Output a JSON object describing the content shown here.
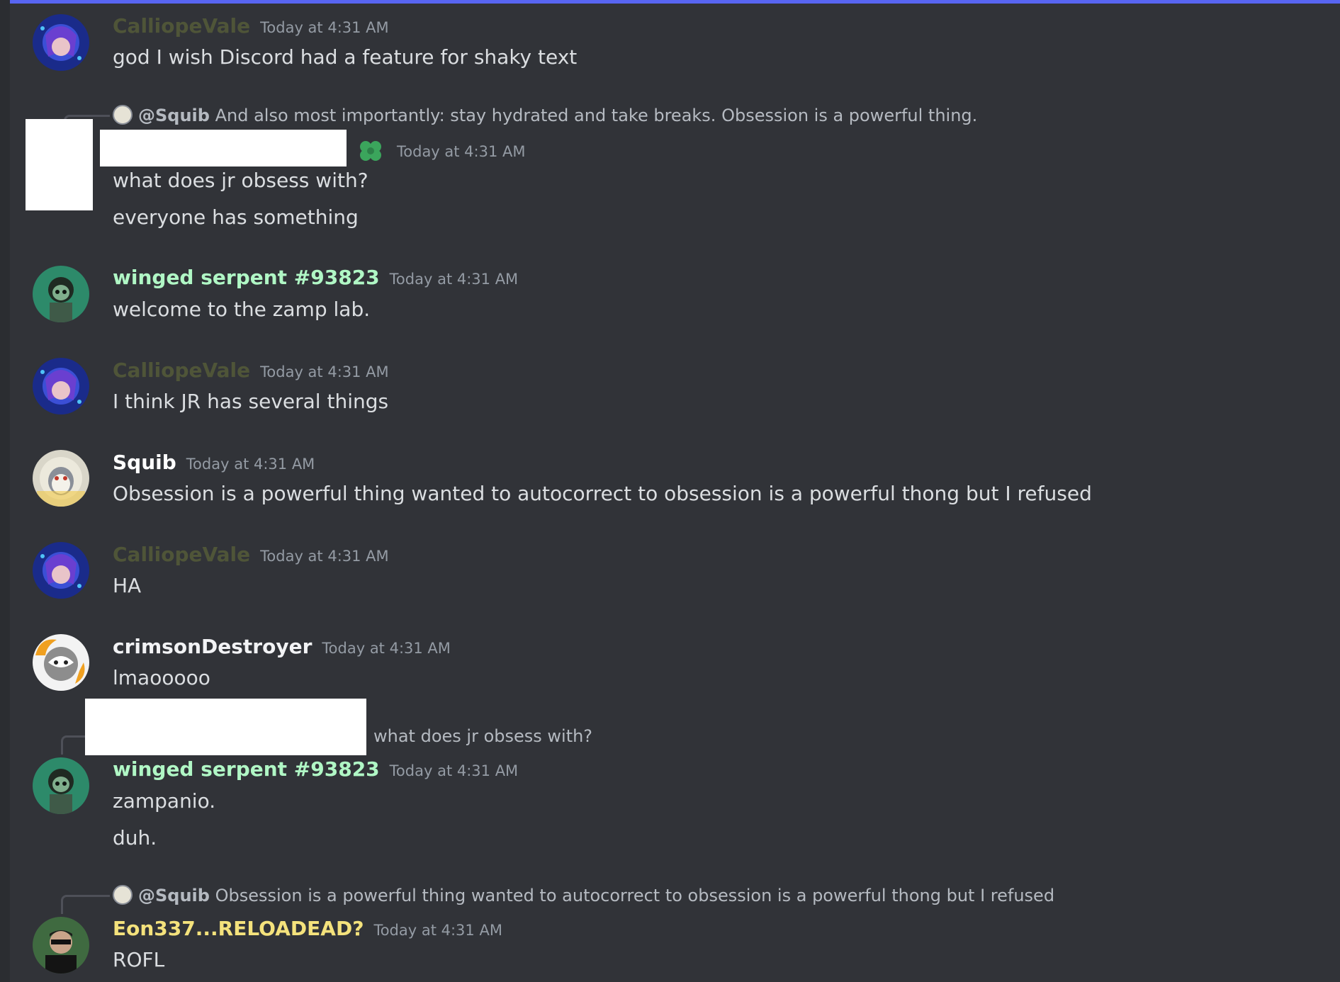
{
  "colors": {
    "background": "#313338",
    "accent_bar": "#5865f2",
    "calliope": "#4f5538",
    "winged": "#b0f7c5",
    "squib": "#ffffff",
    "crimson": "#f2f3f5",
    "eon": "#f4e27c",
    "timestamp": "#949ba4",
    "text": "#dbdee1"
  },
  "messages": [
    {
      "author": "CalliopeVale",
      "timestamp": "Today at 4:31 AM",
      "avatar": "calliope-avatar",
      "lines": [
        "god I wish Discord had a feature for shaky text"
      ]
    },
    {
      "author": "",
      "timestamp": "Today at 4:31 AM",
      "avatar": "redacted-avatar",
      "badge": "clover-icon",
      "reply": {
        "mention": "@Squib",
        "text": "And also most importantly: stay hydrated and take breaks. Obsession is a powerful thing."
      },
      "lines": [
        "what does jr obsess with?",
        "everyone has something"
      ]
    },
    {
      "author": "winged serpent #93823",
      "timestamp": "Today at 4:31 AM",
      "avatar": "winged-serpent-avatar",
      "lines": [
        "welcome to the zamp lab."
      ]
    },
    {
      "author": "CalliopeVale",
      "timestamp": "Today at 4:31 AM",
      "avatar": "calliope-avatar",
      "lines": [
        "I think JR has several things"
      ]
    },
    {
      "author": "Squib",
      "timestamp": "Today at 4:31 AM",
      "avatar": "squib-avatar",
      "lines": [
        "Obsession is a powerful thing wanted to autocorrect to obsession is a powerful thong but I refused"
      ]
    },
    {
      "author": "CalliopeVale",
      "timestamp": "Today at 4:31 AM",
      "avatar": "calliope-avatar",
      "lines": [
        "HA"
      ]
    },
    {
      "author": "crimsonDestroyer",
      "timestamp": "Today at 4:31 AM",
      "avatar": "crimson-avatar",
      "lines": [
        "lmaooooo"
      ]
    },
    {
      "author": "winged serpent #93823",
      "timestamp": "Today at 4:31 AM",
      "avatar": "winged-serpent-avatar",
      "reply": {
        "mention": "",
        "text": "what does jr obsess with?"
      },
      "lines": [
        "zampanio.",
        "duh."
      ]
    },
    {
      "author": "Eon337...RELOADEAD?",
      "timestamp": "Today at 4:31 AM",
      "avatar": "eon-avatar",
      "reply": {
        "mention": "@Squib",
        "text": "Obsession is a powerful thing wanted to autocorrect to obsession is a powerful thong but I refused"
      },
      "lines": [
        "ROFL"
      ]
    }
  ]
}
